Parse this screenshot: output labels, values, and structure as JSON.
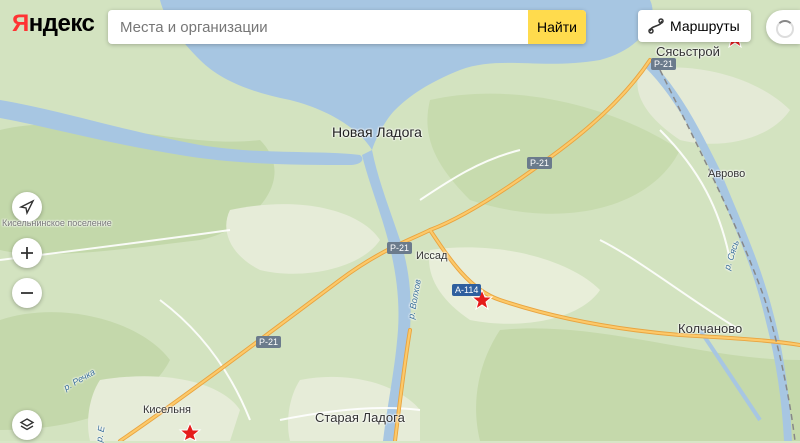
{
  "logo": {
    "first": "Я",
    "rest": "ндекс"
  },
  "search": {
    "placeholder": "Места и организации",
    "value": "",
    "button": "Найти"
  },
  "routes": {
    "label": "Маршруты",
    "icon": "route-icon"
  },
  "controls": [
    {
      "name": "locate-icon"
    },
    {
      "name": "zoom-in-icon"
    },
    {
      "name": "zoom-out-icon"
    },
    {
      "name": "layers-icon"
    }
  ],
  "labels": {
    "novaya_ladoga": "Новая Ладога",
    "syasstroy": "Сясьстрой",
    "avrovo": "Аврово",
    "issad": "Иссад",
    "kolchanovo": "Колчаново",
    "staraya_ladoga": "Старая Ладога",
    "kiselnya": "Кисельня",
    "kiselninskoe": "Кисельнинское поселение",
    "river_volkhov": "р. Волхов",
    "river_syas": "р. Сясь",
    "river_rechka": "р. Речка",
    "river_small": "р. Е"
  },
  "road_shields": [
    {
      "text": "Р-21"
    },
    {
      "text": "Р-21"
    },
    {
      "text": "Р-21"
    },
    {
      "text": "Р-21"
    },
    {
      "text": "А-114"
    }
  ],
  "colors": {
    "water": "#a7c6e2",
    "land": "#d7e6c6",
    "forest": "#c4d9ae",
    "road": "#f4b24f",
    "marker": "#e51b1b",
    "accent": "#ffdb4d"
  }
}
